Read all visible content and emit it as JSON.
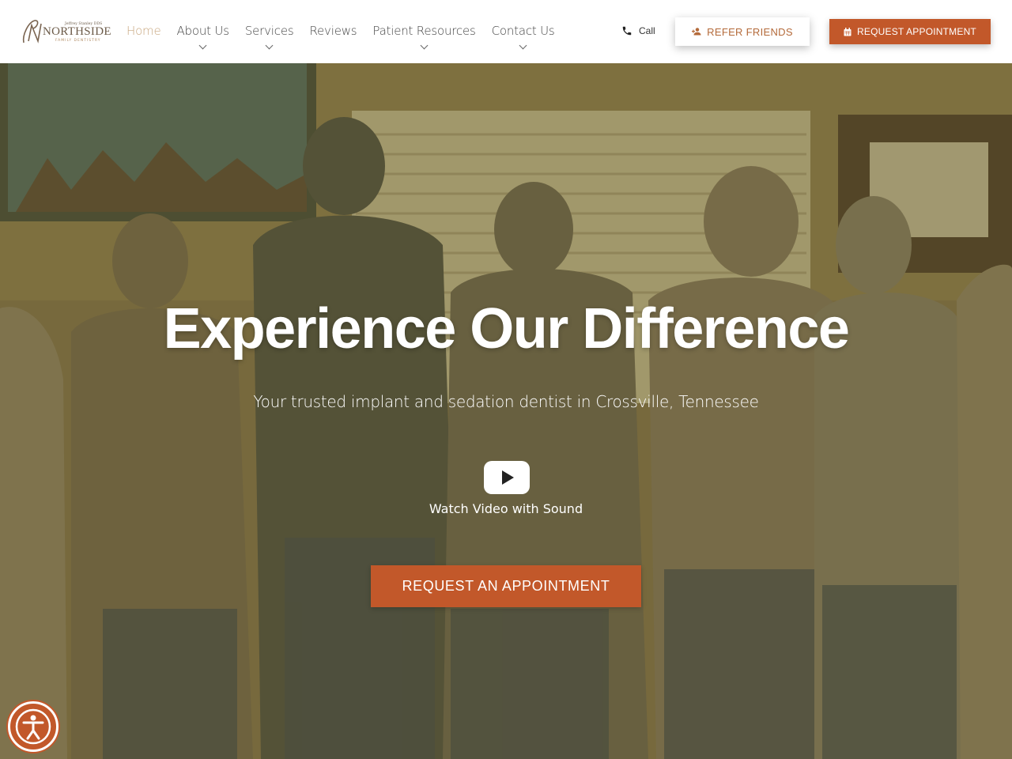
{
  "logo": {
    "doctor": "Jeffrey Stanley DDS",
    "name": "NORTHSIDE",
    "tagline": "FAMILY DENTISTRY"
  },
  "nav": {
    "items": [
      {
        "label": "Home",
        "active": true,
        "has_dropdown": false
      },
      {
        "label": "About Us",
        "active": false,
        "has_dropdown": true
      },
      {
        "label": "Services",
        "active": false,
        "has_dropdown": true
      },
      {
        "label": "Reviews",
        "active": false,
        "has_dropdown": false
      },
      {
        "label": "Patient Resources",
        "active": false,
        "has_dropdown": true
      },
      {
        "label": "Contact Us",
        "active": false,
        "has_dropdown": true
      }
    ]
  },
  "header_actions": {
    "call_label": "Call",
    "refer_label": "REFER FRIENDS",
    "request_label": "REQUEST APPOINTMENT"
  },
  "hero": {
    "title": "Experience Our Difference",
    "subtitle": "Your trusted implant and sedation dentist in Crossville, Tennessee",
    "video_label": "Watch Video with Sound",
    "cta_label": "REQUEST AN APPOINTMENT"
  },
  "icons": {
    "call": "phone-icon",
    "refer": "user-plus-icon",
    "request": "calendar-icon",
    "video": "play-icon",
    "accessibility": "accessibility-icon"
  },
  "colors": {
    "accent": "#c2582a",
    "nav_active": "#c8a67e",
    "refer_text": "#b46a3a",
    "hero_overlay": "#5f5523"
  }
}
